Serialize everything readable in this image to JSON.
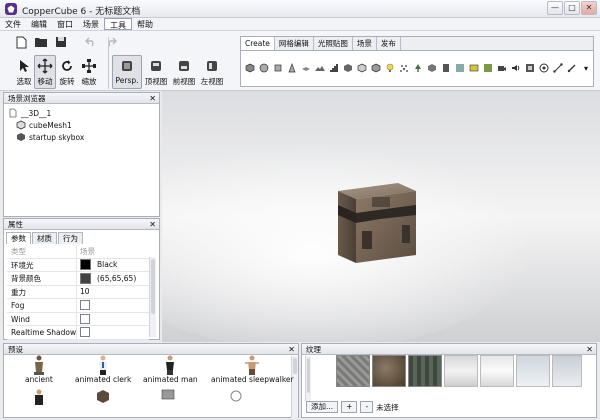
{
  "window": {
    "title": "CopperCube 6 - 无标题文档",
    "min": "—",
    "max": "□",
    "close": "✕"
  },
  "menu": [
    "文件",
    "编辑",
    "窗口",
    "场景",
    "工具",
    "帮助"
  ],
  "toolbar": {
    "tools": [
      {
        "label": "选取",
        "icon": "cursor-icon"
      },
      {
        "label": "移动",
        "icon": "move-icon"
      },
      {
        "label": "旋转",
        "icon": "rotate-icon"
      },
      {
        "label": "缩放",
        "icon": "scale-icon"
      }
    ],
    "views": [
      {
        "label": "Persp.",
        "icon": "perspective-view-icon"
      },
      {
        "label": "顶视图",
        "icon": "top-view-icon"
      },
      {
        "label": "前视图",
        "icon": "front-view-icon"
      },
      {
        "label": "左视图",
        "icon": "left-view-icon"
      }
    ]
  },
  "create": {
    "tabs": [
      "Create",
      "网格编辑",
      "光照贴图",
      "场景",
      "发布"
    ],
    "more": "▾"
  },
  "scene_browser": {
    "title": "场景浏览器",
    "close": "✕",
    "items": [
      "__3D__1",
      "cubeMesh1",
      "startup skybox"
    ]
  },
  "properties": {
    "title": "属性",
    "close": "✕",
    "tabs": [
      "参数",
      "材质",
      "行为"
    ],
    "rows": [
      {
        "name": "类型",
        "value": "场景",
        "type": "text",
        "muted": true
      },
      {
        "name": "环境光",
        "value": "Black",
        "type": "color",
        "color": "#000000"
      },
      {
        "name": "背景颜色",
        "value": "(65,65,65)",
        "type": "color",
        "color": "#414141"
      },
      {
        "name": "重力",
        "value": "10",
        "type": "text"
      },
      {
        "name": "Fog",
        "value": "",
        "type": "check"
      },
      {
        "name": "Wind",
        "value": "",
        "type": "check"
      },
      {
        "name": "Realtime Shadows",
        "value": "",
        "type": "check"
      }
    ]
  },
  "presets": {
    "title": "预设",
    "close": "✕",
    "items": [
      "ancient",
      "animated clerk",
      "animated man",
      "animated sleepwalker"
    ]
  },
  "textures": {
    "title": "纹理",
    "close": "✕",
    "add": "添加...",
    "plus": "+",
    "minus": "-",
    "status": "未选择"
  },
  "colors": {
    "accent": "#5b2d8a",
    "viewport_sky": "#e9eaeb",
    "viewport_floor": "#bdbec1"
  }
}
